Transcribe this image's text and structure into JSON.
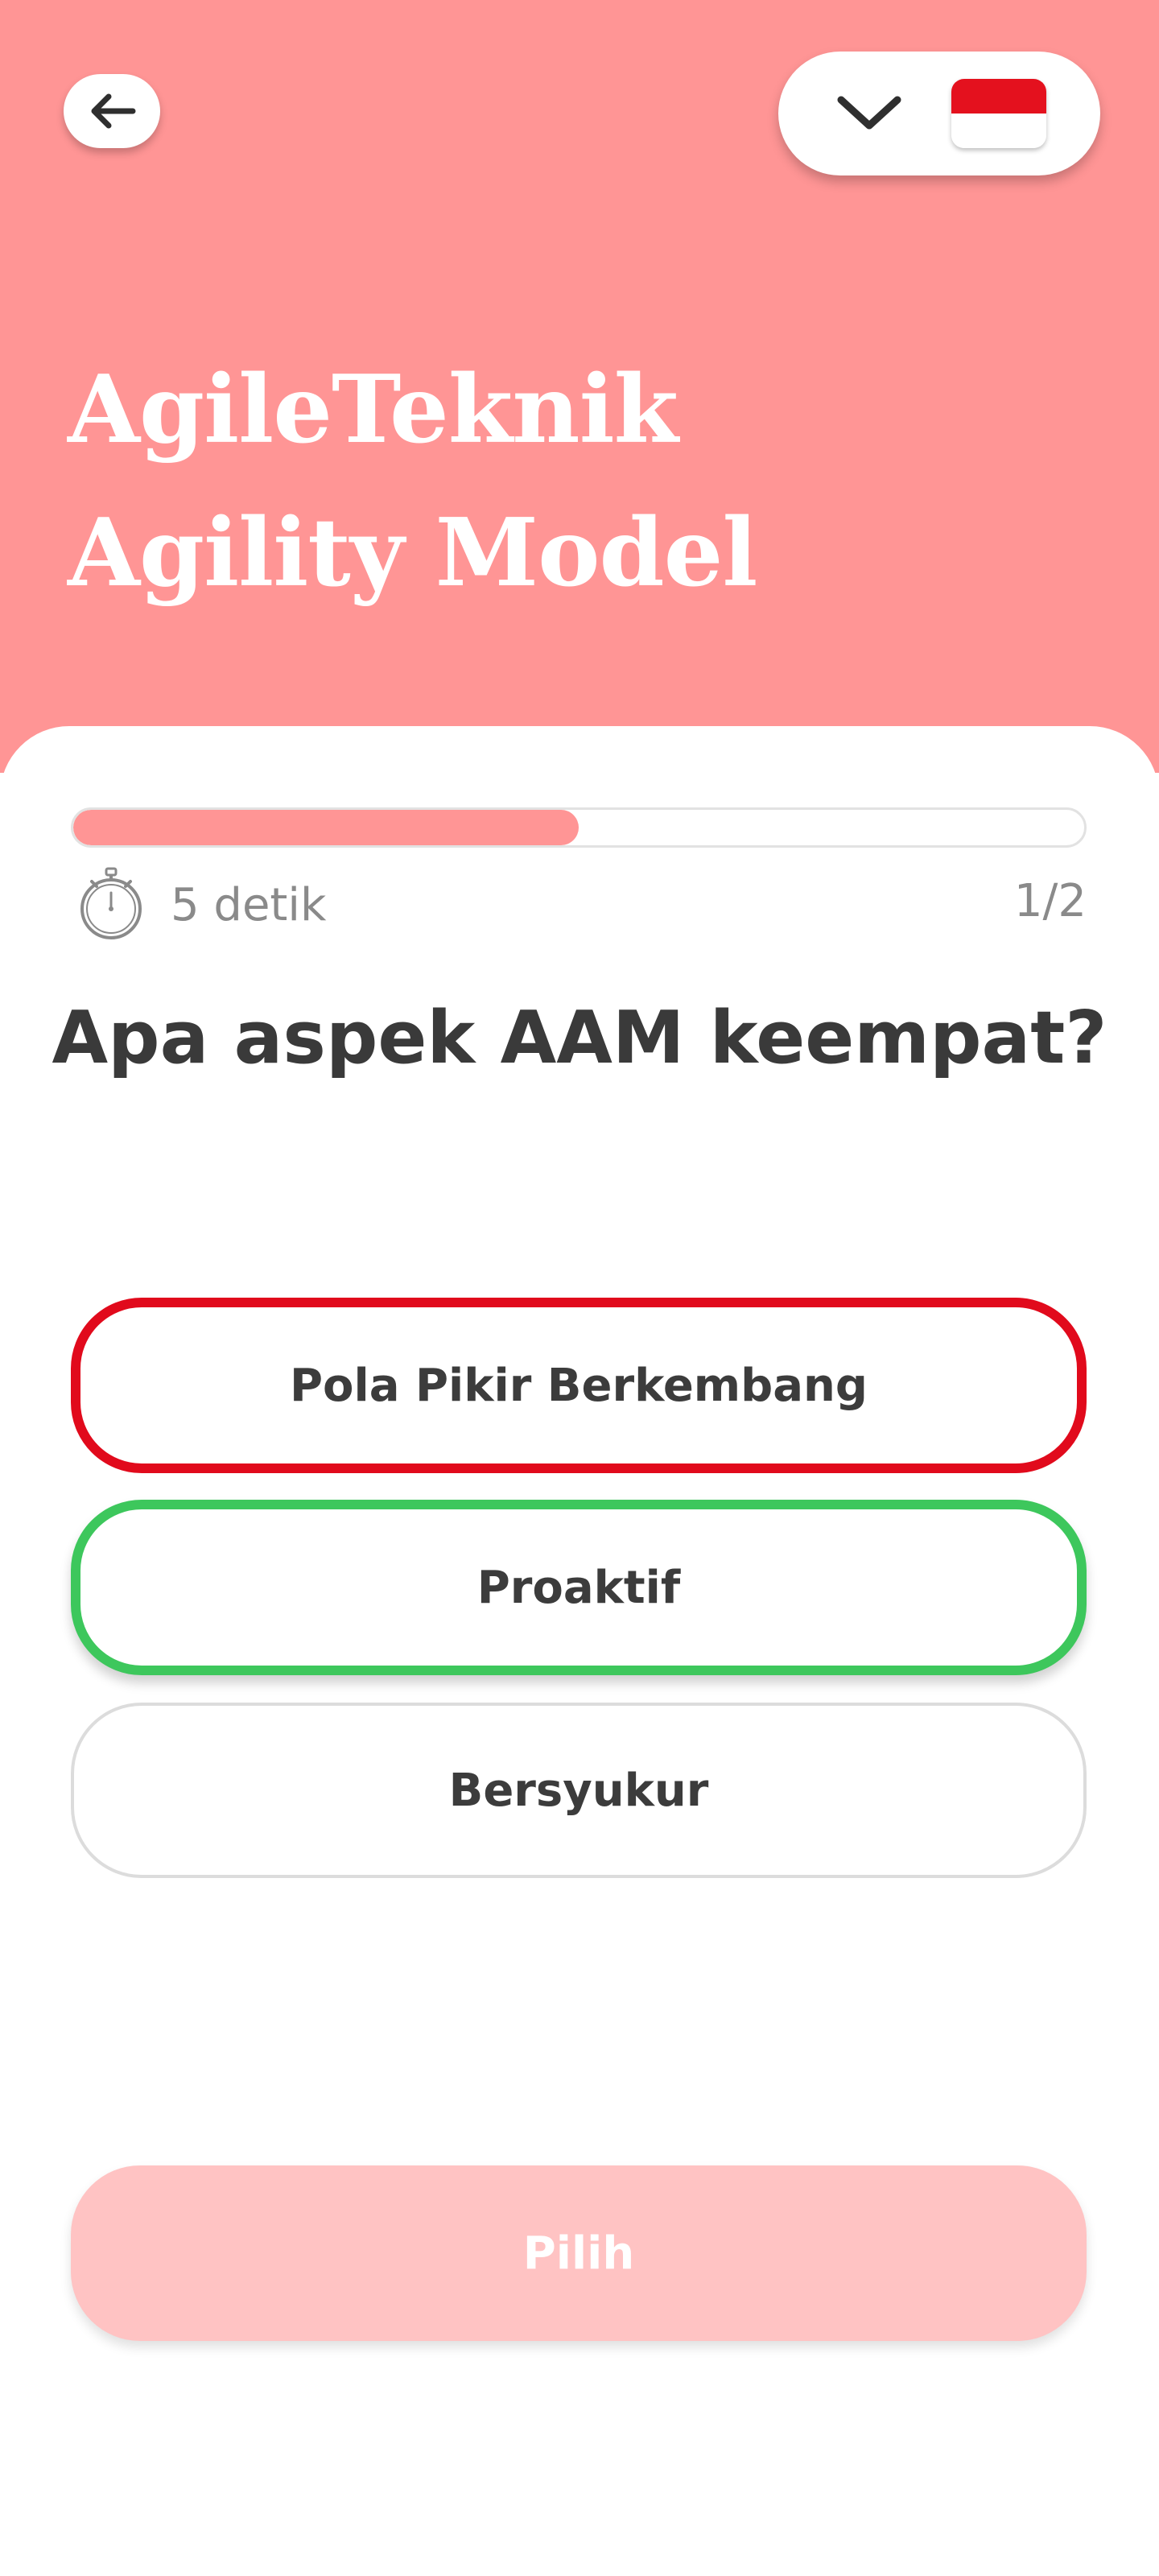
{
  "header": {
    "title": "AgileTeknik Agility Model",
    "background_color": "#ff9595",
    "back_icon": "arrow-left-icon",
    "language_selector": {
      "icon": "chevron-down-icon",
      "flag": "indonesia-flag-icon"
    }
  },
  "quiz": {
    "progress": 0.5,
    "timer_icon": "stopwatch-icon",
    "timer_text": "5 detik",
    "counter": "1/2",
    "question": "Apa aspek AAM keempat?",
    "options": [
      {
        "label": "Pola Pikir Berkembang",
        "state": "wrong",
        "border_color": "#e10a1c"
      },
      {
        "label": "Proaktif",
        "state": "correct",
        "border_color": "#3dc75c"
      },
      {
        "label": "Bersyukur",
        "state": "neutral",
        "border_color": "#dcdcdc"
      }
    ],
    "submit_label": "Pilih",
    "submit_color": "#ffc3c3"
  }
}
